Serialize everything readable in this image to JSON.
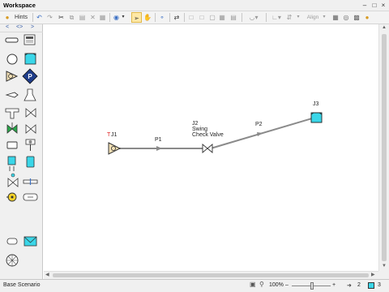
{
  "window": {
    "title": "Workspace"
  },
  "toolbar": {
    "hints_label": "Hints",
    "align_label": "Align",
    "active_tool": "select-arrow"
  },
  "palette": {
    "nav_prev": "<",
    "nav_toggle": "<>",
    "nav_next": ">",
    "items": [
      "pipe",
      "annotation",
      "branch",
      "tank",
      "assigned-flow",
      "assigned-pressure",
      "spray-discharge",
      "area-change",
      "tee",
      "valve",
      "control-valve",
      "check-valve",
      "dead-end",
      "relief-valve",
      "heat-exchanger",
      "reservoir-volume",
      "general-component",
      "orifice",
      "pump",
      "screen",
      "bend",
      "volume-balance",
      "compressor"
    ]
  },
  "model": {
    "junctions": [
      {
        "id": "J1",
        "label": "J1",
        "prefix": "T",
        "type": "assigned-flow"
      },
      {
        "id": "J2",
        "label": "J2",
        "line2": "Swing",
        "line3": "Check Valve",
        "type": "check-valve"
      },
      {
        "id": "J3",
        "label": "J3",
        "type": "reservoir"
      }
    ],
    "pipes": [
      {
        "id": "P1",
        "label": "P1",
        "from": "J1",
        "to": "J2"
      },
      {
        "id": "P2",
        "label": "P2",
        "from": "J2",
        "to": "J3"
      }
    ]
  },
  "colors": {
    "pipe": "#8a8a8a",
    "reservoir": "#3ad6e8",
    "assigned_pressure": "#1f3d8a",
    "junction_fill": "#f3e0b5",
    "red_marker": "#e02020",
    "selected_tool_bg": "#ffe8a6"
  },
  "status": {
    "scenario": "Base Scenario",
    "zoom": "100%",
    "pipe_count": "2",
    "junction_count": "3"
  }
}
